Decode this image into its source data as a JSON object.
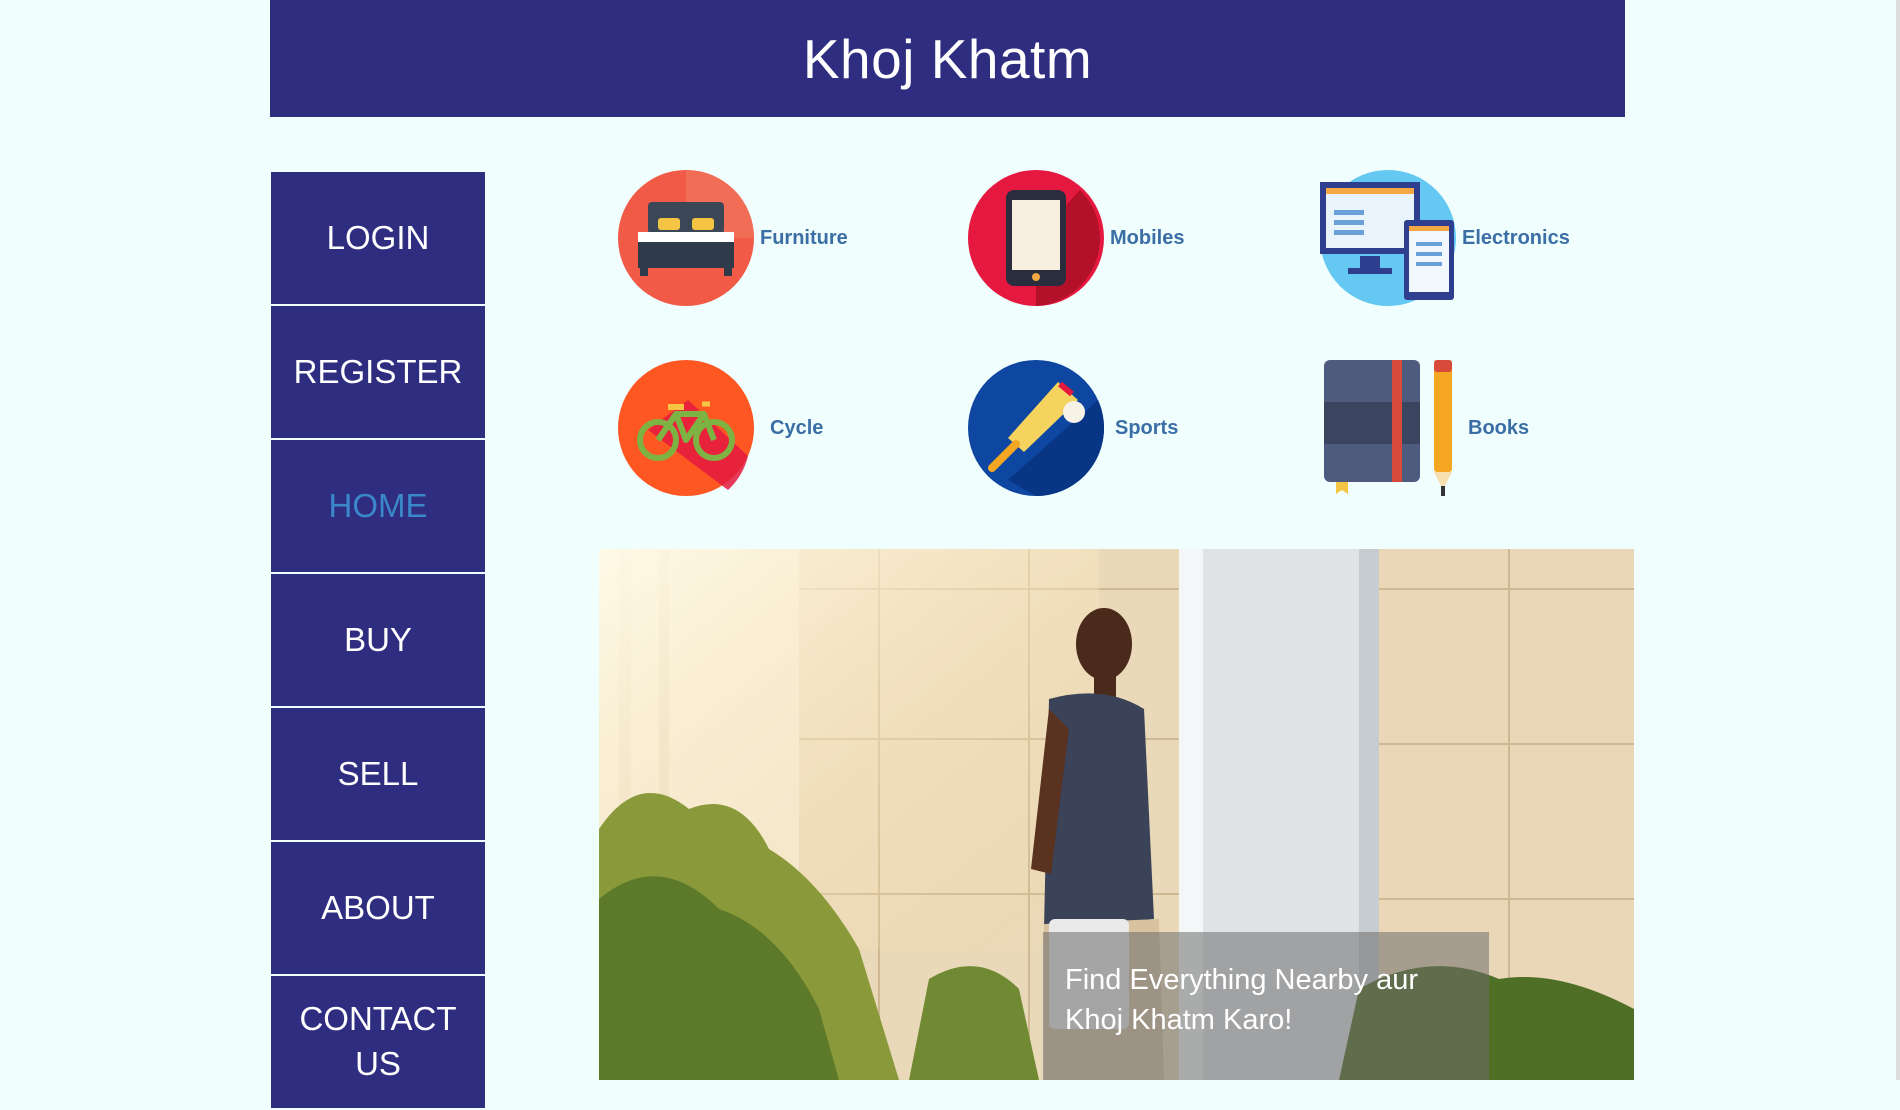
{
  "header": {
    "title": "Khoj Khatm"
  },
  "nav": {
    "items": [
      {
        "label": "LOGIN"
      },
      {
        "label": "REGISTER"
      },
      {
        "label": "HOME"
      },
      {
        "label": "BUY"
      },
      {
        "label": "SELL"
      },
      {
        "label": "ABOUT"
      },
      {
        "label": "CONTACT US"
      }
    ],
    "active": "HOME"
  },
  "categories": [
    {
      "label": "Furniture",
      "icon": "bed-icon"
    },
    {
      "label": "Mobiles",
      "icon": "mobile-phone-icon"
    },
    {
      "label": "Electronics",
      "icon": "computer-devices-icon"
    },
    {
      "label": "Cycle",
      "icon": "bicycle-icon"
    },
    {
      "label": "Sports",
      "icon": "cricket-bat-icon"
    },
    {
      "label": "Books",
      "icon": "book-pencil-icon"
    }
  ],
  "hero": {
    "caption": "Find Everything Nearby aur Khoj Khatm Karo!"
  },
  "colors": {
    "brand": "#2f2d80",
    "background": "#f0fffe",
    "active_nav": "#3a87c9",
    "category_label": "#3a6ea5"
  }
}
